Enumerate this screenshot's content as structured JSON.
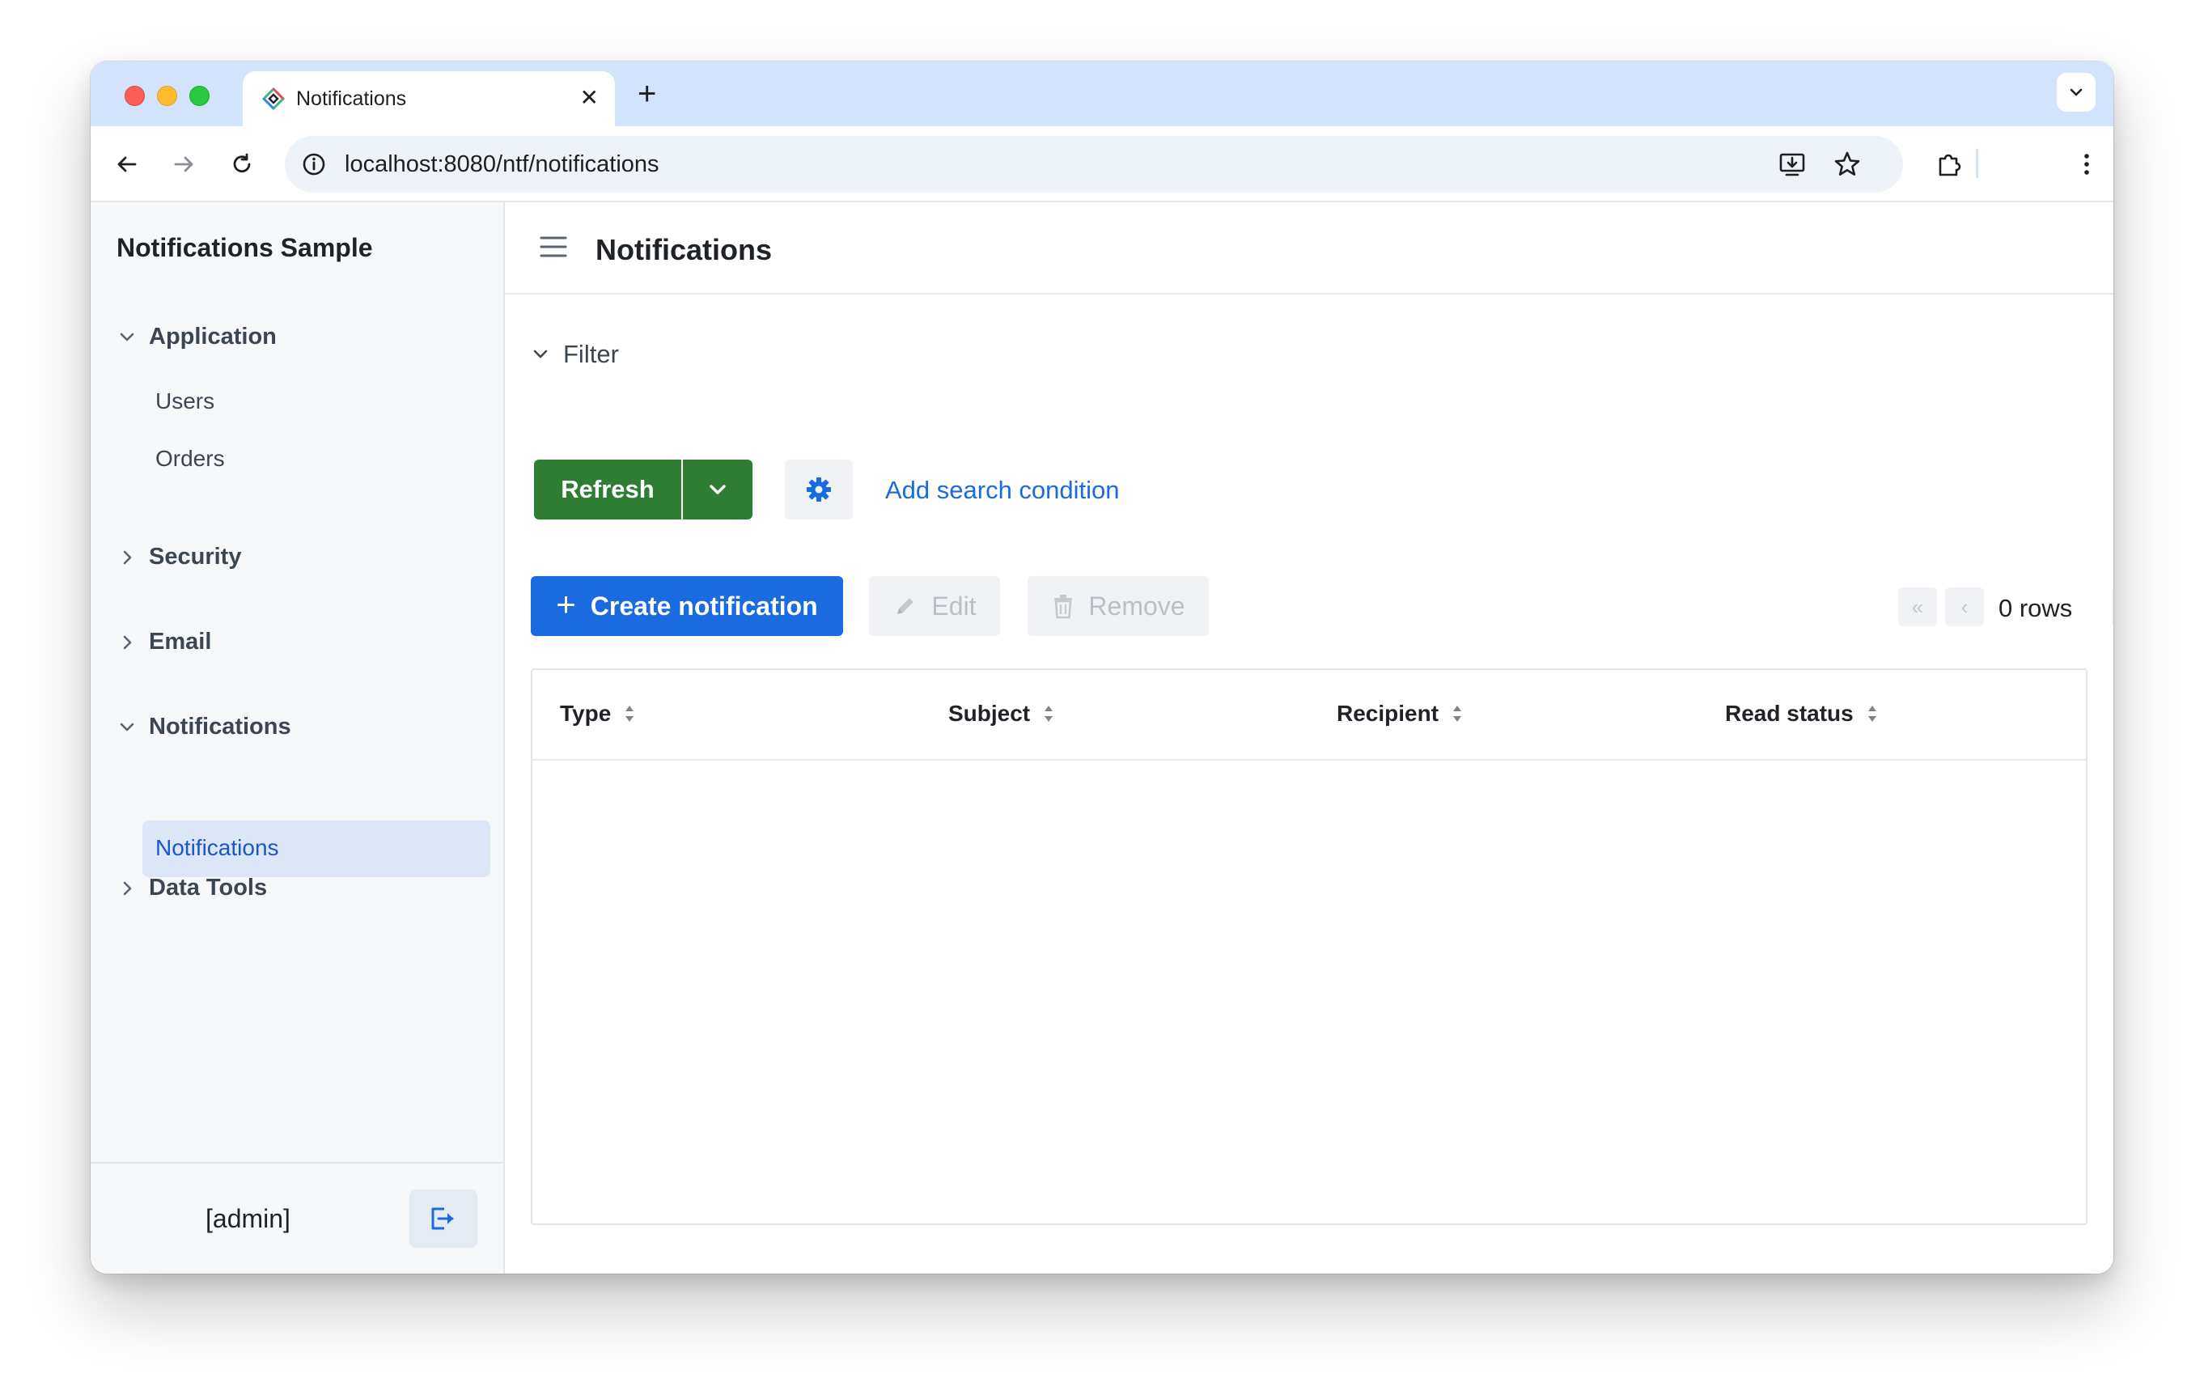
{
  "browser": {
    "tab_title": "Notifications",
    "new_tab_glyph": "+",
    "close_glyph": "✕",
    "url": "localhost:8080/ntf/notifications"
  },
  "sidebar": {
    "app_title": "Notifications Sample",
    "groups": [
      {
        "label": "Application",
        "expanded": true,
        "items": [
          "Users",
          "Orders"
        ]
      },
      {
        "label": "Security",
        "expanded": false
      },
      {
        "label": "Email",
        "expanded": false
      },
      {
        "label": "Notifications",
        "expanded": true,
        "items": [
          "Notifications"
        ],
        "active_item": "Notifications"
      },
      {
        "label": "Data Tools",
        "expanded": false
      }
    ],
    "user_label": "[admin]"
  },
  "main": {
    "page_title": "Notifications",
    "filter_label": "Filter",
    "refresh_label": "Refresh",
    "add_condition_label": "Add search condition",
    "create_label": "Create notification",
    "edit_label": "Edit",
    "remove_label": "Remove",
    "rows_label": "0 rows",
    "columns": [
      "Type",
      "Subject",
      "Recipient",
      "Read status"
    ]
  },
  "colors": {
    "primary": "#1a6ae0",
    "success": "#2e7d32",
    "tabstrip": "#d3e3fd",
    "active_nav_bg": "#dce6f7"
  },
  "icons": [
    "jmix-favicon",
    "back-arrow-icon",
    "forward-arrow-icon",
    "reload-icon",
    "info-icon",
    "install-icon",
    "star-icon",
    "extensions-icon",
    "kebab-menu-icon",
    "chevron-down-icon",
    "chevron-right-icon",
    "hamburger-icon",
    "gear-icon",
    "plus-icon",
    "pencil-icon",
    "trash-icon",
    "sort-icon",
    "logout-icon"
  ]
}
